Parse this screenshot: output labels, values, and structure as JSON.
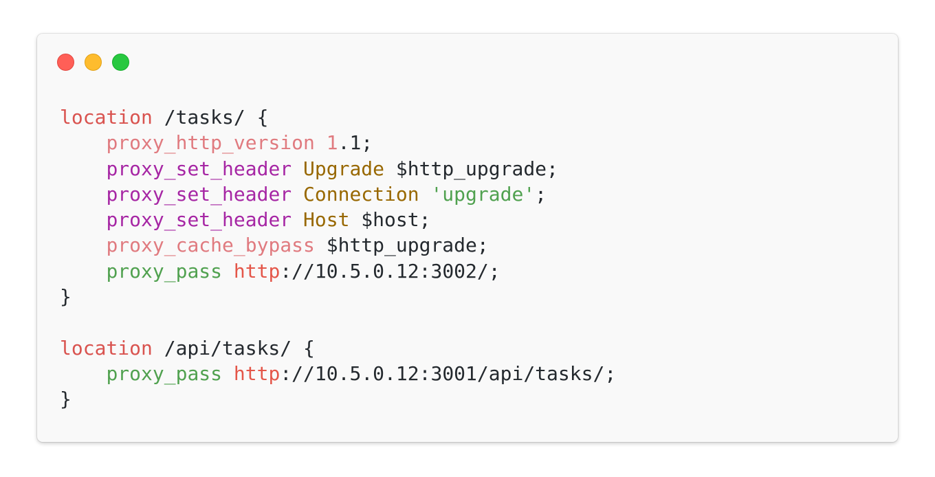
{
  "window": {
    "buttons": [
      "close",
      "minimize",
      "zoom"
    ]
  },
  "code": {
    "block1": {
      "keyword": "location",
      "path": " /tasks/ {",
      "line1": {
        "directive": "proxy_http_version",
        "num": "1",
        "rest": ".1;"
      },
      "line2": {
        "directive": "proxy_set_header",
        "arg": "Upgrade",
        "rest": " $http_upgrade;"
      },
      "line3": {
        "directive": "proxy_set_header",
        "arg": "Connection",
        "str": "'upgrade'",
        "rest": ";"
      },
      "line4": {
        "directive": "proxy_set_header",
        "arg": "Host",
        "rest": " $host;"
      },
      "line5": {
        "directive": "proxy_cache_bypass",
        "rest": " $http_upgrade;"
      },
      "line6": {
        "directive": "proxy_pass",
        "proto": "http",
        "rest": "://10.5.0.12:3002/;"
      },
      "close": "}"
    },
    "block2": {
      "keyword": "location",
      "path": " /api/tasks/ {",
      "line1": {
        "directive": "proxy_pass",
        "proto": "http",
        "rest": "://10.5.0.12:3001/api/tasks/;"
      },
      "close": "}"
    }
  },
  "colors": {
    "keyword": "#d9534f",
    "directive_pink": "#e07a7f",
    "directive_purple": "#a626a4",
    "directive_green": "#50a14f",
    "argument": "#986801",
    "string": "#50a14f",
    "protocol": "#e45649",
    "text": "#24292e"
  }
}
